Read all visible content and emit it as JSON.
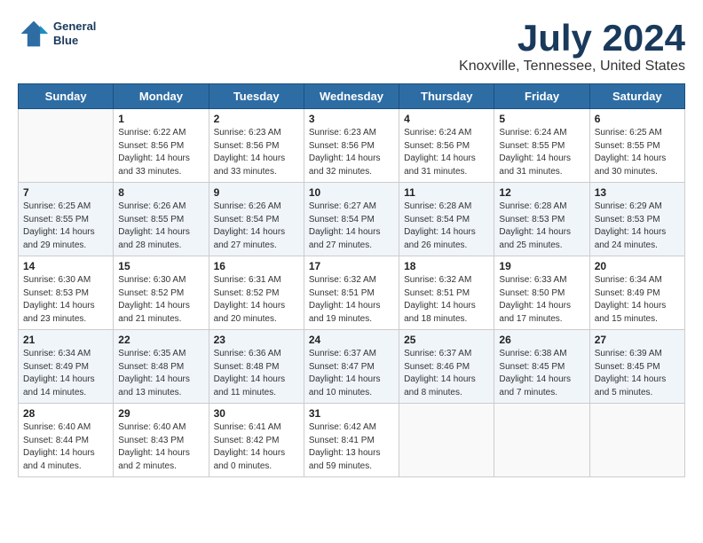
{
  "logo": {
    "line1": "General",
    "line2": "Blue"
  },
  "title": "July 2024",
  "subtitle": "Knoxville, Tennessee, United States",
  "weekdays": [
    "Sunday",
    "Monday",
    "Tuesday",
    "Wednesday",
    "Thursday",
    "Friday",
    "Saturday"
  ],
  "weeks": [
    [
      {
        "day": "",
        "info": ""
      },
      {
        "day": "1",
        "info": "Sunrise: 6:22 AM\nSunset: 8:56 PM\nDaylight: 14 hours\nand 33 minutes."
      },
      {
        "day": "2",
        "info": "Sunrise: 6:23 AM\nSunset: 8:56 PM\nDaylight: 14 hours\nand 33 minutes."
      },
      {
        "day": "3",
        "info": "Sunrise: 6:23 AM\nSunset: 8:56 PM\nDaylight: 14 hours\nand 32 minutes."
      },
      {
        "day": "4",
        "info": "Sunrise: 6:24 AM\nSunset: 8:56 PM\nDaylight: 14 hours\nand 31 minutes."
      },
      {
        "day": "5",
        "info": "Sunrise: 6:24 AM\nSunset: 8:55 PM\nDaylight: 14 hours\nand 31 minutes."
      },
      {
        "day": "6",
        "info": "Sunrise: 6:25 AM\nSunset: 8:55 PM\nDaylight: 14 hours\nand 30 minutes."
      }
    ],
    [
      {
        "day": "7",
        "info": "Sunrise: 6:25 AM\nSunset: 8:55 PM\nDaylight: 14 hours\nand 29 minutes."
      },
      {
        "day": "8",
        "info": "Sunrise: 6:26 AM\nSunset: 8:55 PM\nDaylight: 14 hours\nand 28 minutes."
      },
      {
        "day": "9",
        "info": "Sunrise: 6:26 AM\nSunset: 8:54 PM\nDaylight: 14 hours\nand 27 minutes."
      },
      {
        "day": "10",
        "info": "Sunrise: 6:27 AM\nSunset: 8:54 PM\nDaylight: 14 hours\nand 27 minutes."
      },
      {
        "day": "11",
        "info": "Sunrise: 6:28 AM\nSunset: 8:54 PM\nDaylight: 14 hours\nand 26 minutes."
      },
      {
        "day": "12",
        "info": "Sunrise: 6:28 AM\nSunset: 8:53 PM\nDaylight: 14 hours\nand 25 minutes."
      },
      {
        "day": "13",
        "info": "Sunrise: 6:29 AM\nSunset: 8:53 PM\nDaylight: 14 hours\nand 24 minutes."
      }
    ],
    [
      {
        "day": "14",
        "info": "Sunrise: 6:30 AM\nSunset: 8:53 PM\nDaylight: 14 hours\nand 23 minutes."
      },
      {
        "day": "15",
        "info": "Sunrise: 6:30 AM\nSunset: 8:52 PM\nDaylight: 14 hours\nand 21 minutes."
      },
      {
        "day": "16",
        "info": "Sunrise: 6:31 AM\nSunset: 8:52 PM\nDaylight: 14 hours\nand 20 minutes."
      },
      {
        "day": "17",
        "info": "Sunrise: 6:32 AM\nSunset: 8:51 PM\nDaylight: 14 hours\nand 19 minutes."
      },
      {
        "day": "18",
        "info": "Sunrise: 6:32 AM\nSunset: 8:51 PM\nDaylight: 14 hours\nand 18 minutes."
      },
      {
        "day": "19",
        "info": "Sunrise: 6:33 AM\nSunset: 8:50 PM\nDaylight: 14 hours\nand 17 minutes."
      },
      {
        "day": "20",
        "info": "Sunrise: 6:34 AM\nSunset: 8:49 PM\nDaylight: 14 hours\nand 15 minutes."
      }
    ],
    [
      {
        "day": "21",
        "info": "Sunrise: 6:34 AM\nSunset: 8:49 PM\nDaylight: 14 hours\nand 14 minutes."
      },
      {
        "day": "22",
        "info": "Sunrise: 6:35 AM\nSunset: 8:48 PM\nDaylight: 14 hours\nand 13 minutes."
      },
      {
        "day": "23",
        "info": "Sunrise: 6:36 AM\nSunset: 8:48 PM\nDaylight: 14 hours\nand 11 minutes."
      },
      {
        "day": "24",
        "info": "Sunrise: 6:37 AM\nSunset: 8:47 PM\nDaylight: 14 hours\nand 10 minutes."
      },
      {
        "day": "25",
        "info": "Sunrise: 6:37 AM\nSunset: 8:46 PM\nDaylight: 14 hours\nand 8 minutes."
      },
      {
        "day": "26",
        "info": "Sunrise: 6:38 AM\nSunset: 8:45 PM\nDaylight: 14 hours\nand 7 minutes."
      },
      {
        "day": "27",
        "info": "Sunrise: 6:39 AM\nSunset: 8:45 PM\nDaylight: 14 hours\nand 5 minutes."
      }
    ],
    [
      {
        "day": "28",
        "info": "Sunrise: 6:40 AM\nSunset: 8:44 PM\nDaylight: 14 hours\nand 4 minutes."
      },
      {
        "day": "29",
        "info": "Sunrise: 6:40 AM\nSunset: 8:43 PM\nDaylight: 14 hours\nand 2 minutes."
      },
      {
        "day": "30",
        "info": "Sunrise: 6:41 AM\nSunset: 8:42 PM\nDaylight: 14 hours\nand 0 minutes."
      },
      {
        "day": "31",
        "info": "Sunrise: 6:42 AM\nSunset: 8:41 PM\nDaylight: 13 hours\nand 59 minutes."
      },
      {
        "day": "",
        "info": ""
      },
      {
        "day": "",
        "info": ""
      },
      {
        "day": "",
        "info": ""
      }
    ]
  ]
}
